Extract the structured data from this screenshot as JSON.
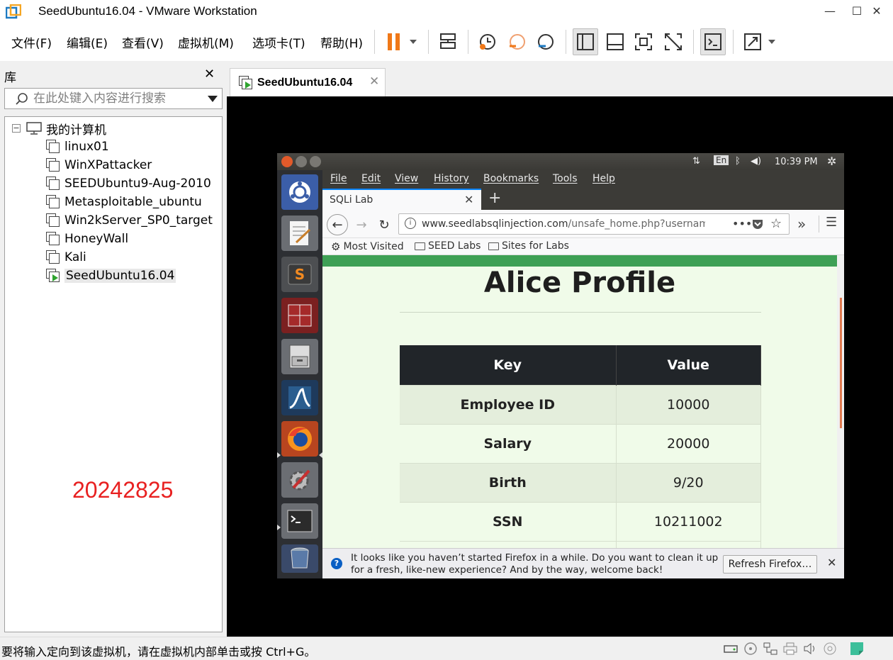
{
  "window": {
    "title": "SeedUbuntu16.04 - VMware Workstation",
    "minimize": "—",
    "maximize": "☐",
    "close": "✕"
  },
  "menu": {
    "file": "文件(F)",
    "edit": "编辑(E)",
    "view": "查看(V)",
    "vm": "虚拟机(M)",
    "tabs": "选项卡(T)",
    "help": "帮助(H)"
  },
  "library": {
    "title": "库",
    "close": "✕",
    "search_placeholder": "在此处键入内容进行搜索",
    "root": "我的计算机",
    "items": [
      {
        "label": "linux01",
        "running": false
      },
      {
        "label": "WinXPattacker",
        "running": false
      },
      {
        "label": "SEEDUbuntu9-Aug-2010",
        "running": false
      },
      {
        "label": "Metasploitable_ubuntu",
        "running": false
      },
      {
        "label": "Win2kServer_SP0_target",
        "running": false
      },
      {
        "label": "HoneyWall",
        "running": false
      },
      {
        "label": "Kali",
        "running": false
      },
      {
        "label": "SeedUbuntu16.04",
        "running": true
      }
    ],
    "watermark": "20242825"
  },
  "vm_tab": {
    "label": "SeedUbuntu16.04",
    "close": "✕"
  },
  "ubuntu": {
    "indicator_lang": "En",
    "time": "10:39 PM"
  },
  "firefox": {
    "menus": [
      "File",
      "Edit",
      "View",
      "History",
      "Bookmarks",
      "Tools",
      "Help"
    ],
    "tab_title": "SQLi Lab",
    "tab_close": "✕",
    "new_tab": "+",
    "url_host": "www.seedlabsqlinjection.com",
    "url_path": "/unsafe_home.php?usernam",
    "bookmarks": [
      "Most Visited",
      "SEED Labs",
      "Sites for Labs"
    ],
    "notice_text": "It looks like you haven’t started Firefox in a while. Do you want to clean it up for a fresh, like-new experience? And by the way, welcome back!",
    "notice_button": "Refresh Firefox…",
    "notice_close": "✕"
  },
  "profile": {
    "title": "Alice Profile",
    "headers": [
      "Key",
      "Value"
    ],
    "rows": [
      {
        "key": "Employee ID",
        "value": "10000"
      },
      {
        "key": "Salary",
        "value": "20000"
      },
      {
        "key": "Birth",
        "value": "9/20"
      },
      {
        "key": "SSN",
        "value": "10211002"
      }
    ]
  },
  "status": {
    "text": "要将输入定向到该虚拟机，请在虚拟机内部单击或按 Ctrl+G。"
  },
  "colors": {
    "accent_orange": "#f07818",
    "green_bar": "#3ea055",
    "table_header": "#212529",
    "watermark": "#e82020"
  }
}
